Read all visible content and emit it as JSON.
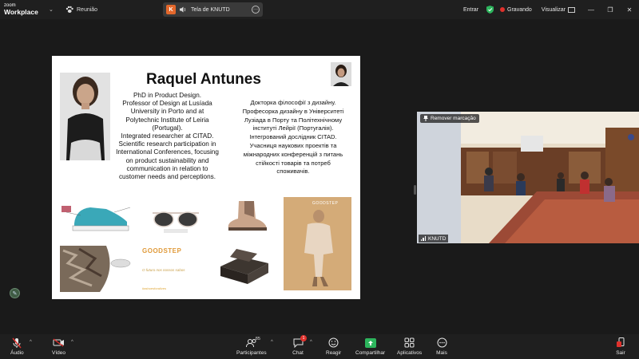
{
  "app": {
    "brand_line1": "zoom",
    "brand_line2": "Workplace",
    "meeting_label": "Reunião"
  },
  "share": {
    "avatar_letter": "K",
    "label": "Tela de KNUTD"
  },
  "topright": {
    "enter_label": "Entrar",
    "recording_label": "Gravando",
    "view_label": "Visualizar"
  },
  "slide": {
    "title": "Raquel Antunes",
    "bio_en": [
      "PhD in Product Design.",
      "Professor of Design at Lusíada",
      "University in Porto and at",
      "Polytechnic Institute of Leiria",
      "(Portugal).",
      "Integrated researcher at CITAD.",
      "Scientific research participation in",
      "International Conferences, focusing",
      "on product sustainability and",
      "communication in relation to",
      "customer needs and perceptions."
    ],
    "bio_ua": [
      "Докторка філософії з дизайну.",
      "Професорка дизайну в Університеті",
      "Лузіада в Порту та Політехнічному",
      "інституті Лейрії (Португалія).",
      "Інтегрований дослідник CITAD.",
      "Учасниця наукових проектів та",
      "міжнародних конференцій з питань",
      "стійкості товарів та потреб",
      "споживачів."
    ],
    "goodstep_logo": "GOODSTEP",
    "goodstep_sub": "O futuro nos nossos sabos",
    "goodstep_tag": "#ashoesforalives",
    "poster_label": "GOODSTEP"
  },
  "video_tile": {
    "remove_label": "Remover marcação",
    "name": "KNUTD"
  },
  "toolbar": {
    "audio": "Áudio",
    "video": "Vídeo",
    "participants": "Participantes",
    "participants_count": "85",
    "chat": "Chat",
    "chat_badge": "1",
    "react": "Reagir",
    "share": "Compartilhar",
    "apps": "Aplicativos",
    "more": "Mais",
    "leave": "Sair"
  },
  "colors": {
    "background": "#1a1a1a",
    "bar": "#1f1f1f",
    "recording": "#e0312c",
    "share_green": "#2db55d",
    "share_avatar": "#e4682c",
    "goodstep": "#e09a3a"
  }
}
